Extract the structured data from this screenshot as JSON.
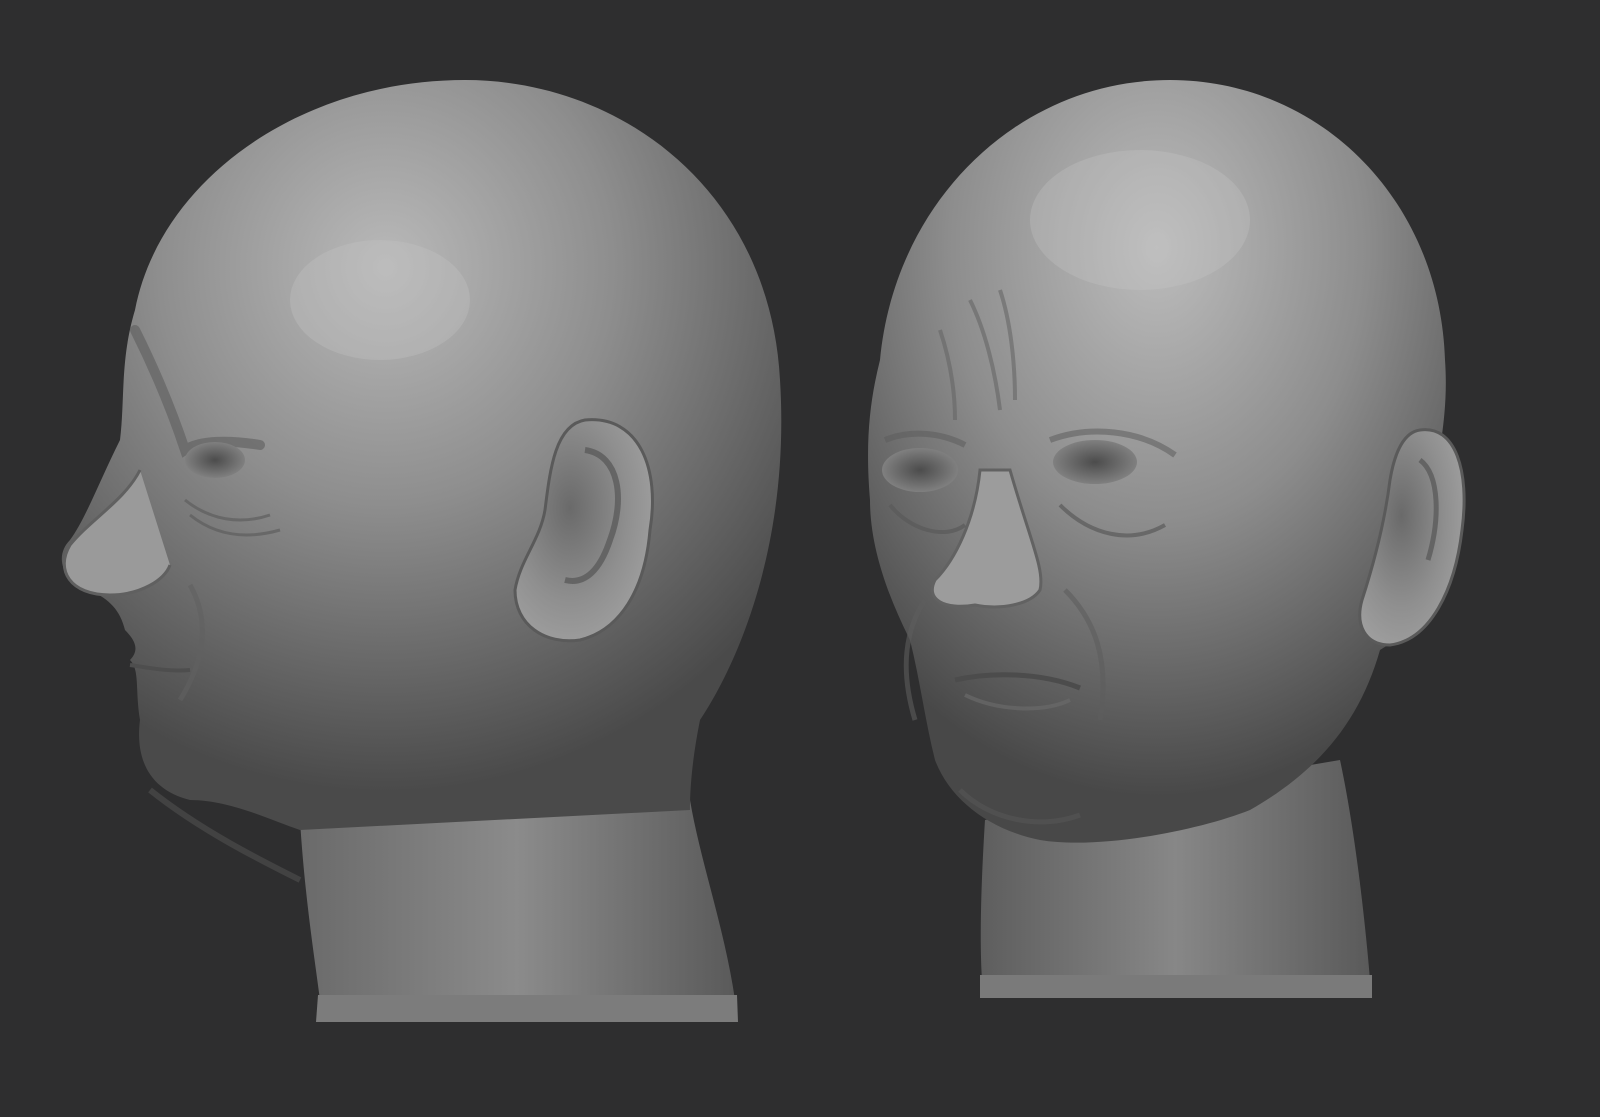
{
  "scene": {
    "description_visible_text": "",
    "background_color": "#2e2e2f",
    "model_color": "#8a8a8a",
    "model_highlight_color": "#b8b8b8",
    "model_shadow_color": "#3c3c3c",
    "views": [
      {
        "name": "profile-view",
        "orientation": "left-profile"
      },
      {
        "name": "three-quarter-view",
        "orientation": "three-quarter-front"
      }
    ]
  }
}
